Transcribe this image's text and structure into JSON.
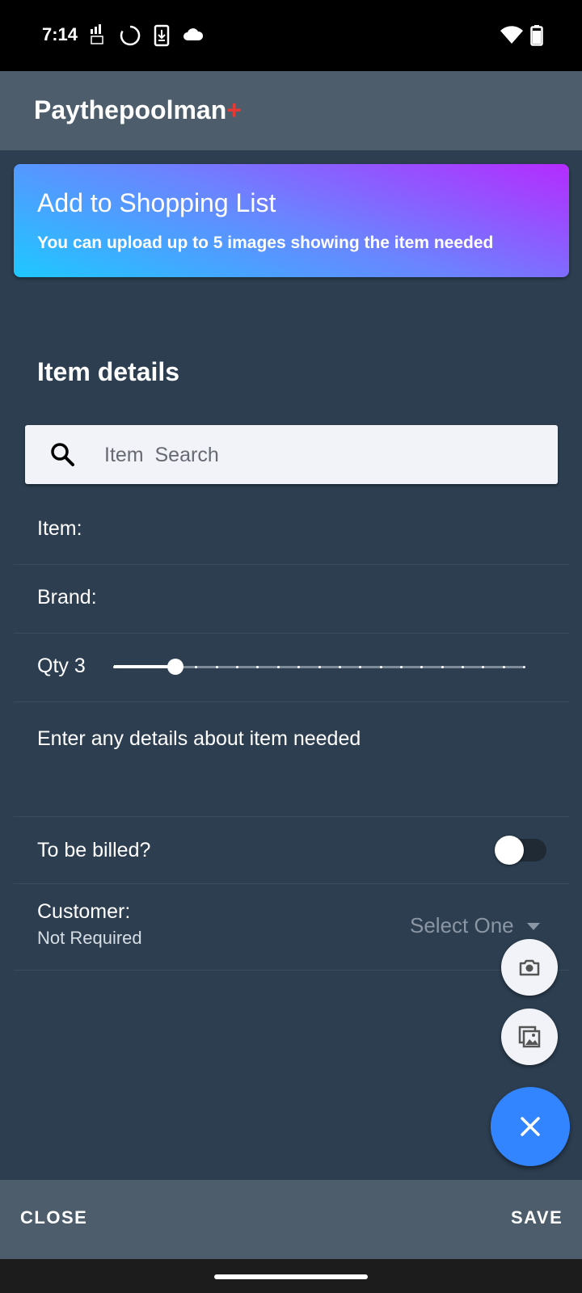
{
  "status_bar": {
    "time": "7:14",
    "icons": [
      "signal-volte-icon",
      "loading-circle-icon",
      "download-icon",
      "cloud-icon",
      "wifi-icon",
      "battery-icon"
    ]
  },
  "app_bar": {
    "title": "Paythepoolman",
    "title_suffix": "+"
  },
  "banner": {
    "title": "Add to Shopping List",
    "subtitle": "You can upload up to 5 images showing the item needed",
    "gradient_colors": [
      "#1ec8ff",
      "#6a85ff",
      "#b52bff"
    ]
  },
  "form": {
    "section_title": "Item details",
    "search_placeholder": "Item  Search",
    "item_label": "Item:",
    "brand_label": "Brand:",
    "qty_label": "Qty 3",
    "qty": {
      "value": 3,
      "min": 0,
      "max": 20
    },
    "details_placeholder": "Enter any details about item needed",
    "billed_label": "To be billed?",
    "billed_value": false,
    "customer_label": "Customer:",
    "customer_sub": "Not Required",
    "customer_select": "Select One"
  },
  "fabs": {
    "camera_icon": "camera-icon",
    "gallery_icon": "gallery-icon",
    "close_icon": "close-icon",
    "main_color": "#3385ff"
  },
  "bottom_bar": {
    "close_label": "CLOSE",
    "save_label": "SAVE"
  },
  "colors": {
    "background": "#2c3e50",
    "app_bar": "#4e5d6c",
    "accent_plus": "#e53935"
  }
}
